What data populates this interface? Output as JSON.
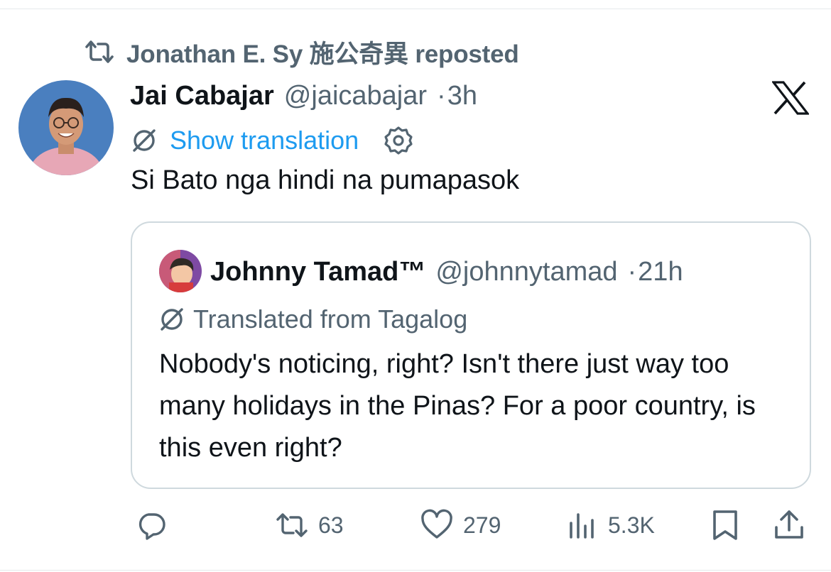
{
  "repost": {
    "icon": "repost-icon",
    "text": "Jonathan E. Sy 施公奇異 reposted"
  },
  "tweet": {
    "display_name": "Jai Cabajar",
    "handle": "@jaicabajar",
    "separator": "·",
    "time": "3h",
    "translate_link": "Show translation",
    "text": "Si Bato nga hindi na pumapasok"
  },
  "quote": {
    "display_name": "Johnny Tamad™",
    "handle": "@johnnytamad",
    "separator": "·",
    "time": "21h",
    "translated_label": "Translated from Tagalog",
    "text": "Nobody's noticing, right? Isn't there just way too many holidays in the Pinas? For a poor country, is this even right?"
  },
  "actions": {
    "reposts": "63",
    "likes": "279",
    "views": "5.3K"
  },
  "colors": {
    "link": "#1d9bf0",
    "secondary": "#536471",
    "primary_text": "#0f1419",
    "border": "#cfd9de"
  }
}
